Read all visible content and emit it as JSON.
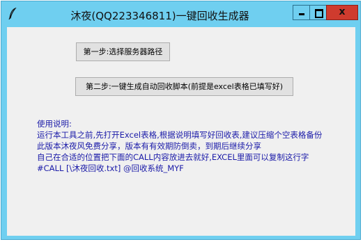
{
  "window": {
    "title": "沐夜(QQ223346811)一键回收生成器",
    "icons": {
      "app": "feather-icon",
      "minimize": "minimize-icon",
      "maximize": "maximize-icon",
      "close": "close-icon"
    },
    "close_glyph": "x",
    "colors": {
      "frame": "#6fcff0",
      "close_button": "#cf3b2e",
      "client": "#f0f0f0",
      "instruction_text": "#1a1aa8"
    }
  },
  "buttons": {
    "step1_label": "第一步:选择服务器路径",
    "step2_label": "第二步:一键生成自动回收脚本(前提是excel表格已填写好)"
  },
  "instructions": {
    "lines": [
      "使用说明:",
      "运行本工具之前,先打开Excel表格,根据说明填写好回收表,建议压缩个空表格备份",
      "此版本沐夜风免费分享，版本有有效期防倒卖，到期后继续分享",
      "自己在合适的位置把下面的CALL内容放进去就好,EXCEL里面可以复制这行字",
      "#CALL [\\沐夜回收.txt] @回收系统_MYF"
    ]
  }
}
